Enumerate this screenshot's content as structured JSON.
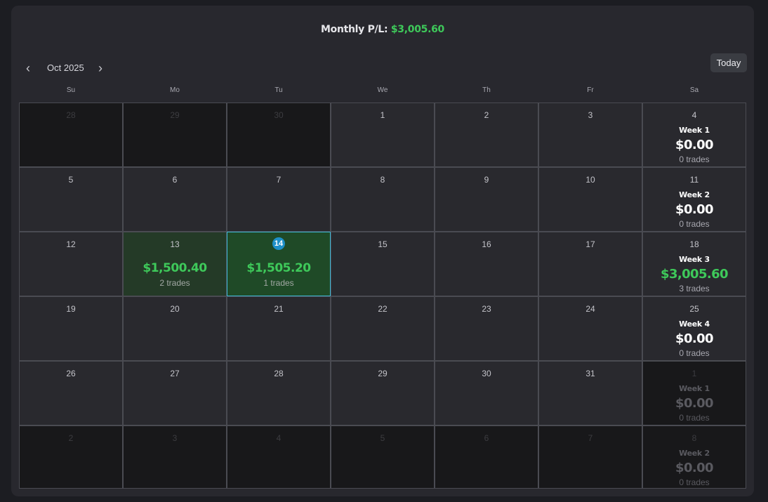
{
  "header": {
    "monthly_label": "Monthly P/L:",
    "monthly_value": "$3,005.60"
  },
  "nav": {
    "month_label": "Oct 2025",
    "prev_glyph": "‹",
    "next_glyph": "›",
    "today_label": "Today"
  },
  "weekdays": [
    "Su",
    "Mo",
    "Tu",
    "We",
    "Th",
    "Fr",
    "Sa"
  ],
  "colors": {
    "profit": "#3ec95a",
    "today_accent": "#1e90c8",
    "panel": "#28282e"
  },
  "weeks": [
    {
      "days": [
        {
          "num": "28",
          "outside": true
        },
        {
          "num": "29",
          "outside": true
        },
        {
          "num": "30",
          "outside": true
        },
        {
          "num": "1"
        },
        {
          "num": "2"
        },
        {
          "num": "3"
        },
        {
          "num": "4",
          "summary": {
            "label": "Week 1",
            "value": "$0.00",
            "trades": "0 trades"
          }
        }
      ]
    },
    {
      "days": [
        {
          "num": "5"
        },
        {
          "num": "6"
        },
        {
          "num": "7"
        },
        {
          "num": "8"
        },
        {
          "num": "9"
        },
        {
          "num": "10"
        },
        {
          "num": "11",
          "summary": {
            "label": "Week 2",
            "value": "$0.00",
            "trades": "0 trades"
          }
        }
      ]
    },
    {
      "days": [
        {
          "num": "12"
        },
        {
          "num": "13",
          "pl": "$1,500.40",
          "trades": "2 trades"
        },
        {
          "num": "14",
          "today": true,
          "pl": "$1,505.20",
          "trades": "1 trades"
        },
        {
          "num": "15"
        },
        {
          "num": "16"
        },
        {
          "num": "17"
        },
        {
          "num": "18",
          "summary": {
            "label": "Week 3",
            "value": "$3,005.60",
            "trades": "3 trades",
            "positive": true
          }
        }
      ]
    },
    {
      "days": [
        {
          "num": "19"
        },
        {
          "num": "20"
        },
        {
          "num": "21"
        },
        {
          "num": "22"
        },
        {
          "num": "23"
        },
        {
          "num": "24"
        },
        {
          "num": "25",
          "summary": {
            "label": "Week 4",
            "value": "$0.00",
            "trades": "0 trades"
          }
        }
      ]
    },
    {
      "days": [
        {
          "num": "26"
        },
        {
          "num": "27"
        },
        {
          "num": "28"
        },
        {
          "num": "29"
        },
        {
          "num": "30"
        },
        {
          "num": "31"
        },
        {
          "num": "1",
          "outside": true,
          "summary": {
            "label": "Week 1",
            "value": "$0.00",
            "trades": "0 trades"
          }
        }
      ]
    },
    {
      "days": [
        {
          "num": "2",
          "outside": true
        },
        {
          "num": "3",
          "outside": true
        },
        {
          "num": "4",
          "outside": true
        },
        {
          "num": "5",
          "outside": true
        },
        {
          "num": "6",
          "outside": true
        },
        {
          "num": "7",
          "outside": true
        },
        {
          "num": "8",
          "outside": true,
          "summary": {
            "label": "Week 2",
            "value": "$0.00",
            "trades": "0 trades"
          }
        }
      ]
    }
  ]
}
